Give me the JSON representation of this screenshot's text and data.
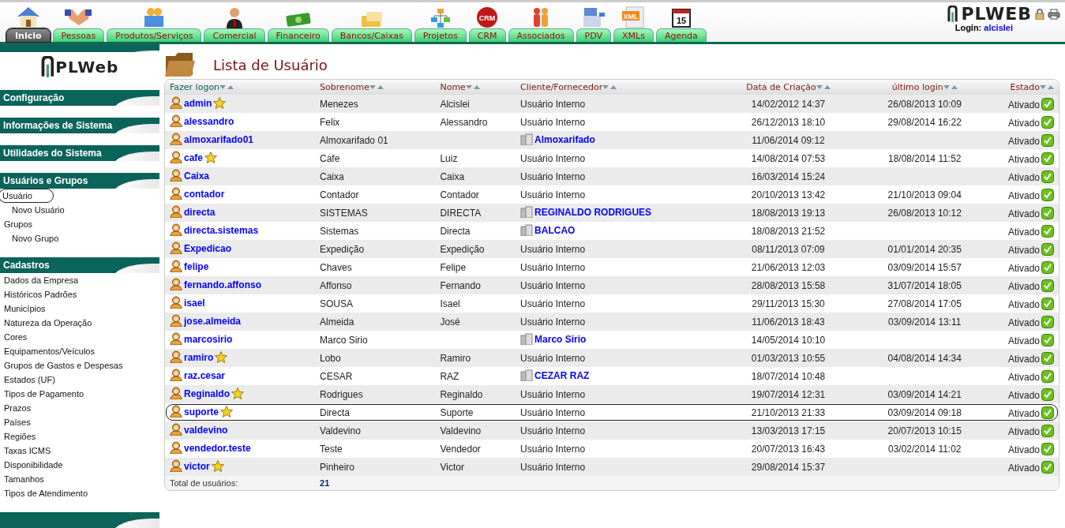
{
  "nav_tabs": [
    {
      "label": "Inicio",
      "selected": true
    },
    {
      "label": "Pessoas",
      "selected": false
    },
    {
      "label": "Produtos/Serviços",
      "selected": false
    },
    {
      "label": "Comercial",
      "selected": false
    },
    {
      "label": "Financeiro",
      "selected": false
    },
    {
      "label": "Bancos/Caixas",
      "selected": false
    },
    {
      "label": "Projetos",
      "selected": false
    },
    {
      "label": "CRM",
      "selected": false,
      "icon_text": "CRM"
    },
    {
      "label": "Associados",
      "selected": false
    },
    {
      "label": "PDV",
      "selected": false
    },
    {
      "label": "XMLs",
      "selected": false,
      "icon_text": "XML"
    },
    {
      "label": "Agenda",
      "selected": false,
      "icon_text": "15"
    }
  ],
  "header": {
    "logo": "PLWEB",
    "login_label": "Login:",
    "login_user": "alcislei"
  },
  "sidebar": {
    "logo": "PLWeb",
    "sections": [
      {
        "title": "Configuração"
      },
      {
        "title": "Informações de Sistema"
      },
      {
        "title": "Utilidades do Sistema"
      },
      {
        "title": "Usuários e Grupos",
        "items": [
          {
            "label": "Usuário",
            "selected": true,
            "children": [
              {
                "label": "Novo Usuário",
                "selected": false
              }
            ]
          },
          {
            "label": "Grupos",
            "selected": false,
            "children": [
              {
                "label": "Novo Grupo",
                "selected": false
              }
            ]
          }
        ]
      },
      {
        "title": "Cadastros",
        "items": [
          {
            "label": "Dados da Empresa",
            "selected": false
          },
          {
            "label": "Históricos Padrões",
            "selected": false
          },
          {
            "label": "Municípios",
            "selected": false
          },
          {
            "label": "Natureza da Operação",
            "selected": false
          },
          {
            "label": "Cores",
            "selected": false
          },
          {
            "label": "Equipamentos/Veículos",
            "selected": false
          },
          {
            "label": "Grupos de Gastos e Despesas",
            "selected": false
          },
          {
            "label": "Estados (UF)",
            "selected": false
          },
          {
            "label": "Tipos de Pagamento",
            "selected": false
          },
          {
            "label": "Prazos",
            "selected": false
          },
          {
            "label": "Países",
            "selected": false
          },
          {
            "label": "Regiões",
            "selected": false
          },
          {
            "label": "Taxas ICMS",
            "selected": false
          },
          {
            "label": "Disponibilidade",
            "selected": false
          },
          {
            "label": "Tamanhos",
            "selected": false
          },
          {
            "label": "Tipos de Atendimento",
            "selected": false
          }
        ]
      }
    ]
  },
  "page_title": "Lista de Usuário",
  "table": {
    "columns": [
      "Fazer logon",
      "Sobrenome",
      "Nome",
      "Cliente/Fornecedor",
      "Data de Criação",
      "último login",
      "Estado"
    ],
    "rows": [
      {
        "login": "admin",
        "starred": true,
        "sobrenome": "Menezes",
        "nome": "Alcislei",
        "cliente": {
          "kind": "internal",
          "text": "Usuário Interno"
        },
        "created": "14/02/2012 14:37",
        "last_login": "26/08/2013 10:09",
        "status": "Ativado",
        "active": true,
        "selected": false
      },
      {
        "login": "alessandro",
        "starred": false,
        "sobrenome": "Felix",
        "nome": "Alessandro",
        "cliente": {
          "kind": "internal",
          "text": "Usuário Interno"
        },
        "created": "26/12/2013 18:10",
        "last_login": "29/08/2014 16:22",
        "status": "Ativado",
        "active": true,
        "selected": false
      },
      {
        "login": "almoxarifado01",
        "starred": false,
        "sobrenome": "Almoxarifado 01",
        "cliente": {
          "kind": "company",
          "text": "Almoxarifado"
        },
        "created": "11/06/2014 09:12",
        "status": "Ativado",
        "active": true,
        "selected": false
      },
      {
        "login": "cafe",
        "starred": true,
        "sobrenome": "Cafe",
        "nome": "Luiz",
        "cliente": {
          "kind": "internal",
          "text": "Usuário Interno"
        },
        "created": "14/08/2014 07:53",
        "last_login": "18/08/2014 11:52",
        "status": "Ativado",
        "active": true,
        "selected": false
      },
      {
        "login": "Caixa",
        "starred": false,
        "sobrenome": "Caixa",
        "nome": "Caixa",
        "cliente": {
          "kind": "internal",
          "text": "Usuário Interno"
        },
        "created": "16/03/2014 15:24",
        "status": "Ativado",
        "active": true,
        "selected": false
      },
      {
        "login": "contador",
        "starred": false,
        "sobrenome": "Contador",
        "nome": "Contador",
        "cliente": {
          "kind": "internal",
          "text": "Usuário Interno"
        },
        "created": "20/10/2013 13:42",
        "last_login": "21/10/2013 09:04",
        "status": "Ativado",
        "active": true,
        "selected": false
      },
      {
        "login": "directa",
        "starred": false,
        "sobrenome": "SISTEMAS",
        "nome": "DIRECTA",
        "cliente": {
          "kind": "company",
          "text": "REGINALDO RODRIGUES"
        },
        "created": "18/08/2013 19:13",
        "last_login": "26/08/2013 10:12",
        "status": "Ativado",
        "active": true,
        "selected": false
      },
      {
        "login": "directa.sistemas",
        "starred": false,
        "sobrenome": "Sistemas",
        "nome": "Directa",
        "cliente": {
          "kind": "company",
          "text": "BALCAO"
        },
        "created": "18/08/2013 21:52",
        "status": "Ativado",
        "active": true,
        "selected": false
      },
      {
        "login": "Expedicao",
        "starred": false,
        "sobrenome": "Expedição",
        "nome": "Expedição",
        "cliente": {
          "kind": "internal",
          "text": "Usuário Interno"
        },
        "created": "08/11/2013 07:09",
        "last_login": "01/01/2014 20:35",
        "status": "Ativado",
        "active": true,
        "selected": false
      },
      {
        "login": "felipe",
        "starred": false,
        "sobrenome": "Chaves",
        "nome": "Felipe",
        "cliente": {
          "kind": "internal",
          "text": "Usuário Interno"
        },
        "created": "21/06/2013 12:03",
        "last_login": "03/09/2014 15:57",
        "status": "Ativado",
        "active": true,
        "selected": false
      },
      {
        "login": "fernando.affonso",
        "starred": false,
        "sobrenome": "Affonso",
        "nome": "Fernando",
        "cliente": {
          "kind": "internal",
          "text": "Usuário Interno"
        },
        "created": "28/08/2013 15:58",
        "last_login": "31/07/2014 18:05",
        "status": "Ativado",
        "active": true,
        "selected": false
      },
      {
        "login": "isael",
        "starred": false,
        "sobrenome": "SOUSA",
        "nome": "Isael",
        "cliente": {
          "kind": "internal",
          "text": "Usuário Interno"
        },
        "created": "29/11/2013 15:30",
        "last_login": "27/08/2014 17:05",
        "status": "Ativado",
        "active": true,
        "selected": false
      },
      {
        "login": "jose.almeida",
        "starred": false,
        "sobrenome": "Almeida",
        "nome": "José",
        "cliente": {
          "kind": "internal",
          "text": "Usuário Interno"
        },
        "created": "11/06/2013 18:43",
        "last_login": "03/09/2014 13:11",
        "status": "Ativado",
        "active": true,
        "selected": false
      },
      {
        "login": "marcosirio",
        "starred": false,
        "sobrenome": "Marco Sirio",
        "cliente": {
          "kind": "company",
          "text": "Marco Sirio"
        },
        "created": "14/05/2014 10:10",
        "status": "Ativado",
        "active": true,
        "selected": false
      },
      {
        "login": "ramiro",
        "starred": true,
        "sobrenome": "Lobo",
        "nome": "Ramiro",
        "cliente": {
          "kind": "internal",
          "text": "Usuário Interno"
        },
        "created": "01/03/2013 10:55",
        "last_login": "04/08/2014 14:34",
        "status": "Ativado",
        "active": true,
        "selected": false
      },
      {
        "login": "raz.cesar",
        "starred": false,
        "sobrenome": "CESAR",
        "nome": "RAZ",
        "cliente": {
          "kind": "company",
          "text": "CEZAR RAZ"
        },
        "created": "18/07/2014 10:48",
        "status": "Ativado",
        "active": true,
        "selected": false
      },
      {
        "login": "Reginaldo",
        "starred": true,
        "sobrenome": "Rodrigues",
        "nome": "Reginaldo",
        "cliente": {
          "kind": "internal",
          "text": "Usuário Interno"
        },
        "created": "19/07/2014 12:31",
        "last_login": "03/09/2014 14:21",
        "status": "Ativado",
        "active": true,
        "selected": false
      },
      {
        "login": "suporte",
        "starred": true,
        "sobrenome": "Directa",
        "nome": "Suporte",
        "cliente": {
          "kind": "internal",
          "text": "Usuário Interno"
        },
        "created": "21/10/2013 21:33",
        "last_login": "03/09/2014 09:18",
        "status": "Ativado",
        "active": true,
        "selected": true
      },
      {
        "login": "valdevino",
        "starred": false,
        "sobrenome": "Valdevino",
        "nome": "Valdevino",
        "cliente": {
          "kind": "internal",
          "text": "Usuário Interno"
        },
        "created": "13/03/2013 17:15",
        "last_login": "20/07/2013 10:15",
        "status": "Ativado",
        "active": true,
        "selected": false
      },
      {
        "login": "vendedor.teste",
        "starred": false,
        "sobrenome": "Teste",
        "nome": "Vendedor",
        "cliente": {
          "kind": "internal",
          "text": "Usuário Interno"
        },
        "created": "20/07/2013 16:43",
        "last_login": "03/02/2014 11:02",
        "status": "Ativado",
        "active": true,
        "selected": false
      },
      {
        "login": "victor",
        "starred": true,
        "sobrenome": "Pinheiro",
        "nome": "Victor",
        "cliente": {
          "kind": "internal",
          "text": "Usuário Interno"
        },
        "created": "29/08/2014 15:37",
        "status": "Ativado",
        "active": true,
        "selected": false
      }
    ],
    "total_label": "Total de usuários:",
    "total_value": "21"
  }
}
